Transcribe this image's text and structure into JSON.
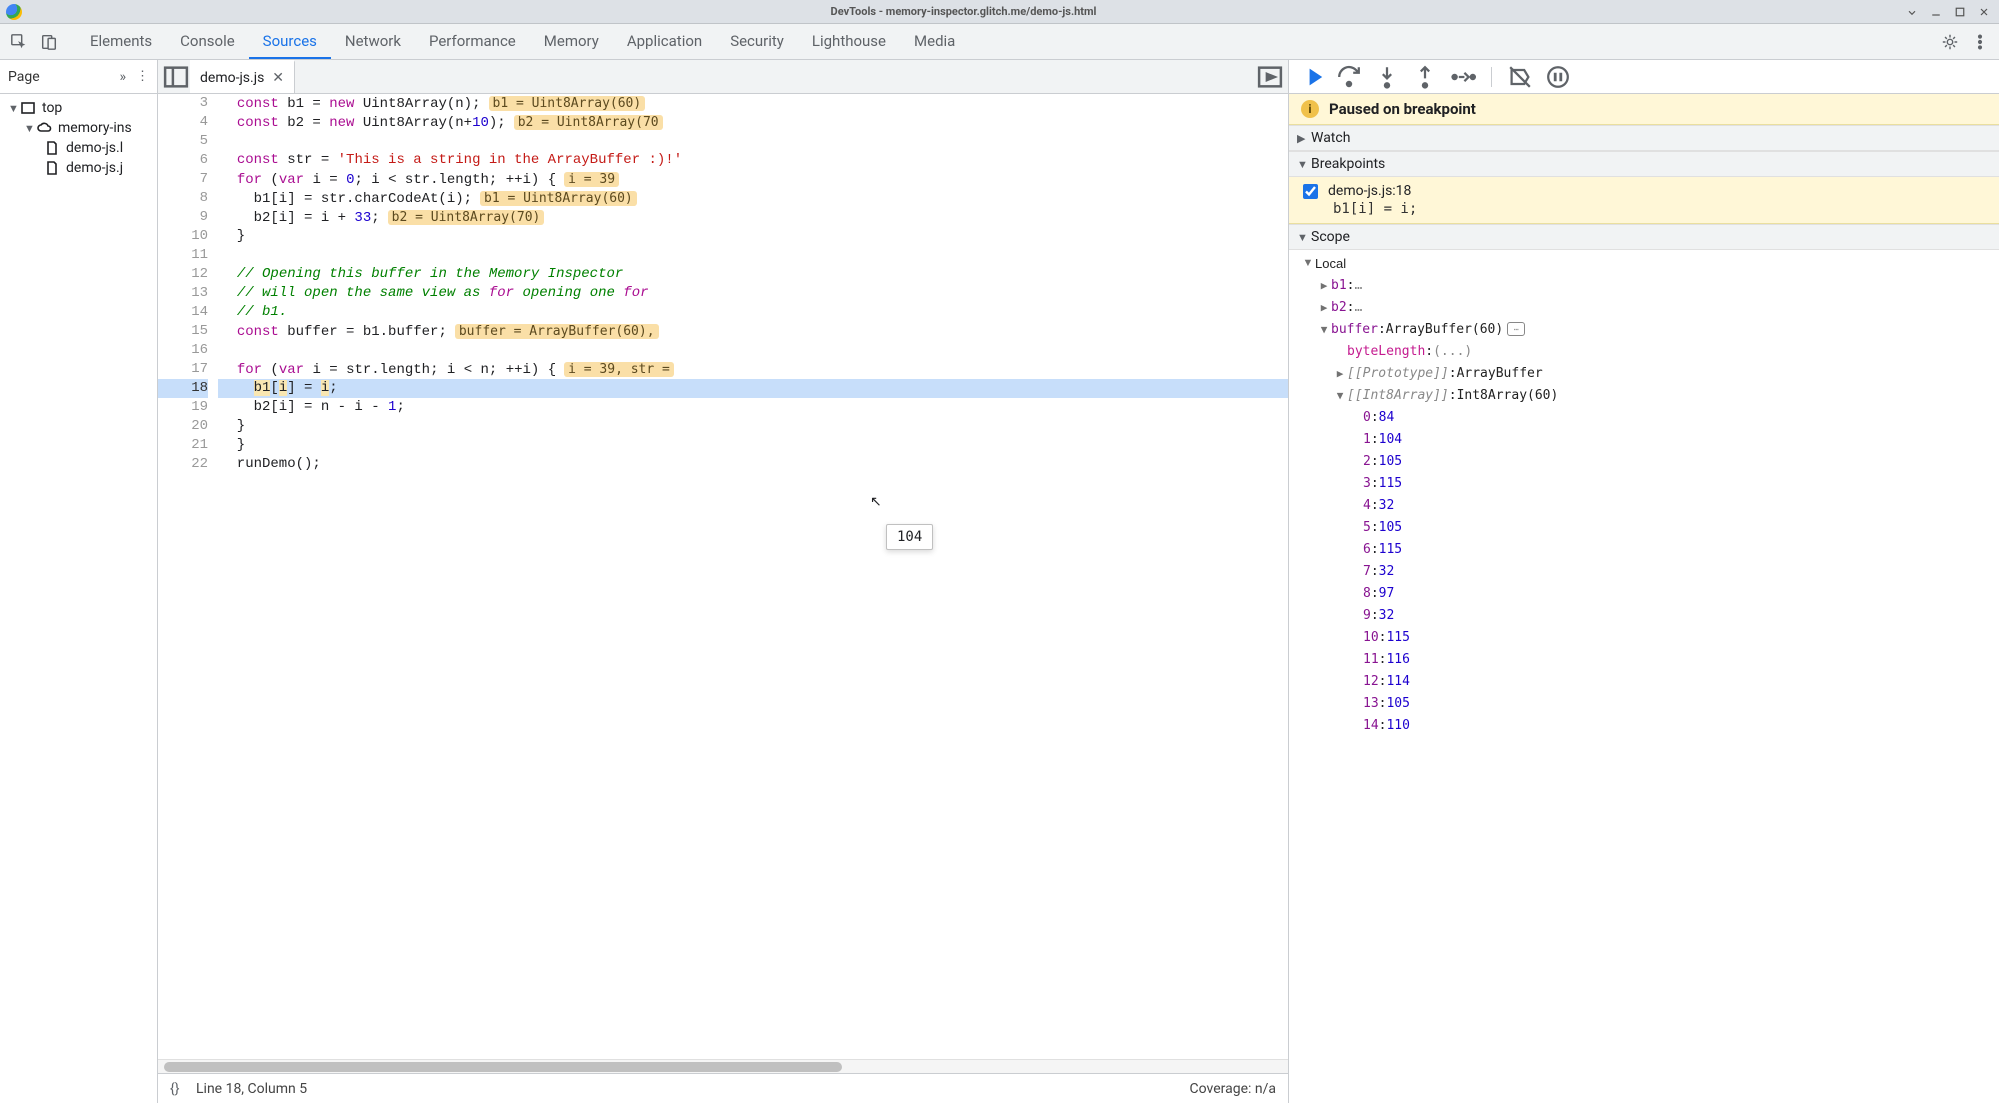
{
  "window": {
    "title": "DevTools - memory-inspector.glitch.me/demo-js.html"
  },
  "main_tabs": [
    "Elements",
    "Console",
    "Sources",
    "Network",
    "Performance",
    "Memory",
    "Application",
    "Security",
    "Lighthouse",
    "Media"
  ],
  "active_tab": "Sources",
  "sidebar": {
    "header": "Page",
    "tree": {
      "root": "top",
      "domain": "memory-ins",
      "files": [
        "demo-js.l",
        "demo-js.j"
      ]
    }
  },
  "editor": {
    "open_file": "demo-js.js",
    "first_line_no": 3,
    "breakpoint_line": 18,
    "lines": [
      {
        "n": 3,
        "code": "const b1 = new Uint8Array(n);",
        "inline": "b1 = Uint8Array(60)"
      },
      {
        "n": 4,
        "code": "const b2 = new Uint8Array(n+10);",
        "inline": "b2 = Uint8Array(70"
      },
      {
        "n": 5,
        "code": ""
      },
      {
        "n": 6,
        "code": "const str = 'This is a string in the ArrayBuffer :)!'"
      },
      {
        "n": 7,
        "code": "for (var i = 0; i < str.length; ++i) {",
        "inline": "i = 39"
      },
      {
        "n": 8,
        "code": "  b1[i] = str.charCodeAt(i);",
        "inline": "b1 = Uint8Array(60)"
      },
      {
        "n": 9,
        "code": "  b2[i] = i + 33;",
        "inline": "b2 = Uint8Array(70)"
      },
      {
        "n": 10,
        "code": "}"
      },
      {
        "n": 11,
        "code": ""
      },
      {
        "n": 12,
        "code": "// Opening this buffer in the Memory Inspector"
      },
      {
        "n": 13,
        "code": "// will open the same view as for opening one for"
      },
      {
        "n": 14,
        "code": "// b1."
      },
      {
        "n": 15,
        "code": "const buffer = b1.buffer;",
        "inline": "buffer = ArrayBuffer(60),"
      },
      {
        "n": 16,
        "code": ""
      },
      {
        "n": 17,
        "code": "for (var i = str.length; i < n; ++i) {",
        "inline": "i = 39, str ="
      },
      {
        "n": 18,
        "code": "  b1[i] = i;",
        "exec": true
      },
      {
        "n": 19,
        "code": "  b2[i] = n - i - 1;"
      },
      {
        "n": 20,
        "code": "}"
      },
      {
        "n": 21,
        "code": "}"
      },
      {
        "n": 22,
        "code": "runDemo();"
      }
    ],
    "status": {
      "position": "Line 18, Column 5",
      "coverage": "Coverage: n/a"
    }
  },
  "debugger": {
    "pause_msg": "Paused on breakpoint",
    "sections": {
      "watch": "Watch",
      "breakpoints": "Breakpoints",
      "scope": "Scope"
    },
    "breakpoint": {
      "label": "demo-js.js:18",
      "code": "b1[i] = i;",
      "checked": true
    },
    "scope": {
      "local_label": "Local",
      "vars": {
        "b1": "…",
        "b2": "…",
        "buffer": "ArrayBuffer(60)",
        "byteLength": "(...)",
        "prototype": "ArrayBuffer",
        "int8array": "Int8Array(60)"
      },
      "array_entries": [
        {
          "i": 0,
          "v": 84
        },
        {
          "i": 1,
          "v": 104
        },
        {
          "i": 2,
          "v": 105
        },
        {
          "i": 3,
          "v": 115
        },
        {
          "i": 4,
          "v": 32
        },
        {
          "i": 5,
          "v": 105
        },
        {
          "i": 6,
          "v": 115
        },
        {
          "i": 7,
          "v": 32
        },
        {
          "i": 8,
          "v": 97
        },
        {
          "i": 9,
          "v": 32
        },
        {
          "i": 10,
          "v": 115
        },
        {
          "i": 11,
          "v": 116
        },
        {
          "i": 12,
          "v": 114
        },
        {
          "i": 13,
          "v": 105
        },
        {
          "i": 14,
          "v": 110
        }
      ]
    },
    "tooltip": "104"
  }
}
